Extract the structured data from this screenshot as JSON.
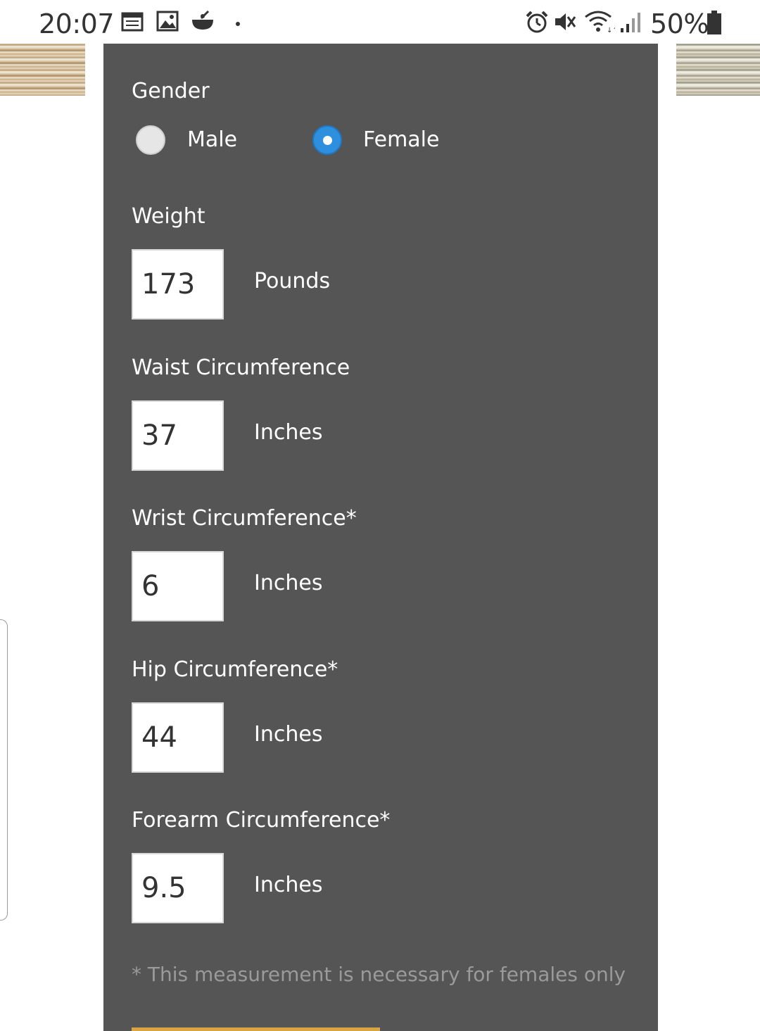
{
  "status_bar": {
    "time": "20:07",
    "left_icons": [
      "calendar-icon",
      "gallery-icon",
      "cooking-pot-icon",
      "notification-dot-icon"
    ],
    "right_icons": [
      "alarm-icon",
      "vibrate-mute-icon",
      "wifi-icon",
      "signal-icon",
      "battery-icon"
    ],
    "battery": "50%"
  },
  "form": {
    "gender": {
      "label": "Gender",
      "options": [
        {
          "label": "Male",
          "selected": false
        },
        {
          "label": "Female",
          "selected": true
        }
      ]
    },
    "weight": {
      "label": "Weight",
      "value": "173",
      "unit": "Pounds"
    },
    "waist": {
      "label": "Waist Circumference",
      "value": "37",
      "unit": "Inches"
    },
    "wrist": {
      "label": "Wrist Circumference*",
      "value": "6",
      "unit": "Inches"
    },
    "hip": {
      "label": "Hip Circumference*",
      "value": "44",
      "unit": "Inches"
    },
    "forearm": {
      "label": "Forearm Circumference*",
      "value": "9.5",
      "unit": "Inches"
    },
    "footnote": "* This measurement is necessary for females only"
  },
  "colors": {
    "panel_bg": "#555555",
    "radio_selected": "#2d8fde",
    "accent_bar": "#d9a441"
  }
}
